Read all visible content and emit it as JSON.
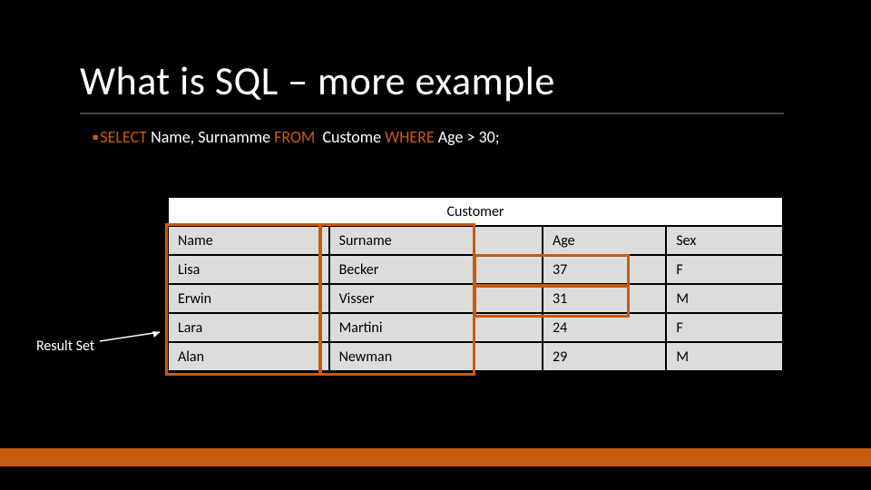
{
  "title": "What is SQL – more example",
  "sql": {
    "kw1": "SELECT",
    "part1": " Name, Surnamme ",
    "kw2": "FROM",
    "part2": "  Custome ",
    "kw3": "WHERE",
    "part3": " Age > 30;"
  },
  "table": {
    "caption": "Customer",
    "headers": [
      "Name",
      "Surname",
      "Age",
      "Sex"
    ],
    "rows": [
      [
        "Lisa",
        "Becker",
        "37",
        "F"
      ],
      [
        "Erwin",
        "Visser",
        "31",
        "M"
      ],
      [
        "Lara",
        "Martini",
        "24",
        "F"
      ],
      [
        "Alan",
        "Newman",
        "29",
        "M"
      ]
    ]
  },
  "result_label": "Result Set",
  "colors": {
    "accent": "#c75b12",
    "bg": "#000000"
  },
  "chart_data": {
    "type": "table",
    "title": "Customer",
    "columns": [
      "Name",
      "Surname",
      "Age",
      "Sex"
    ],
    "rows": [
      {
        "Name": "Lisa",
        "Surname": "Becker",
        "Age": 37,
        "Sex": "F"
      },
      {
        "Name": "Erwin",
        "Surname": "Visser",
        "Age": 31,
        "Sex": "M"
      },
      {
        "Name": "Lara",
        "Surname": "Martini",
        "Age": 24,
        "Sex": "F"
      },
      {
        "Name": "Alan",
        "Surname": "Newman",
        "Age": 29,
        "Sex": "M"
      }
    ],
    "highlighted_columns": [
      "Name",
      "Surname"
    ],
    "highlighted_age_cells": [
      37,
      31
    ]
  }
}
